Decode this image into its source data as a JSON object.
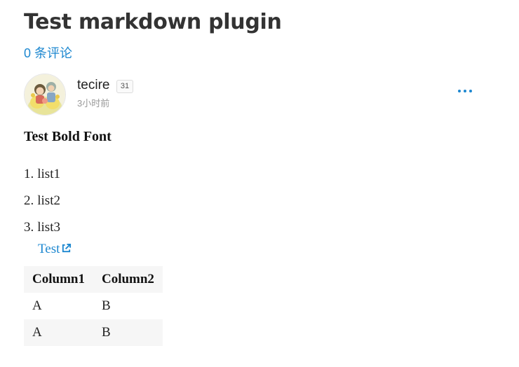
{
  "post": {
    "title": "Test markdown plugin",
    "comments_link": "0 条评论"
  },
  "author": {
    "name": "tecire",
    "badge_count": "31",
    "time": "3小时前"
  },
  "menu": {
    "icon": "ellipsis-icon"
  },
  "content": {
    "bold_text": "Test Bold Font",
    "list": [
      {
        "num": "1.",
        "text": "list1"
      },
      {
        "num": "2.",
        "text": "list2"
      },
      {
        "num": "3.",
        "text": "list3"
      }
    ],
    "link_text": "Test",
    "link_icon": "external-link-icon",
    "table": {
      "headers": [
        "Column1",
        "Column2"
      ],
      "rows": [
        [
          "A",
          "B"
        ],
        [
          "A",
          "B"
        ]
      ]
    }
  },
  "colors": {
    "link": "#1e88d0",
    "title": "#333333",
    "muted": "#999999",
    "table_stripe": "#f6f6f6"
  }
}
